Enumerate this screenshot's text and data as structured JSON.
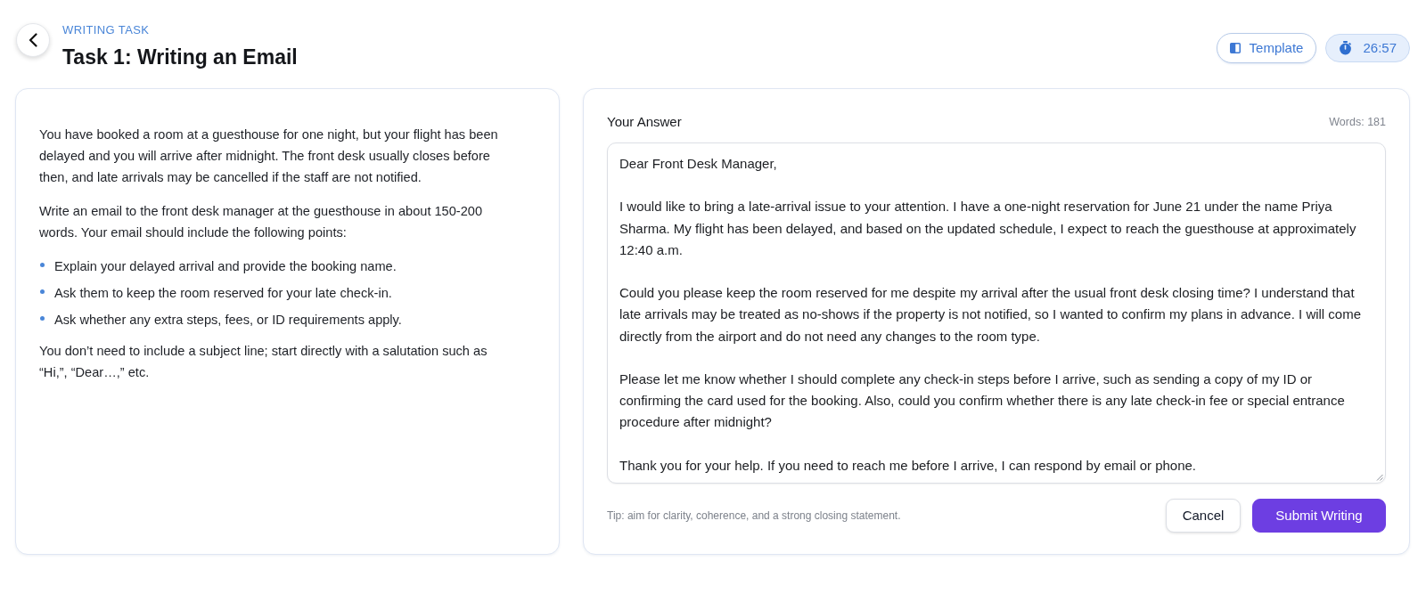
{
  "header": {
    "eyebrow": "WRITING TASK",
    "title": "Task 1: Writing an Email"
  },
  "toolbar": {
    "template_button": "Template",
    "timer": "26:57"
  },
  "prompt": {
    "intro": [
      "You have booked a room at a guesthouse for one night, but your flight has been delayed and you will arrive after midnight. The front desk usually closes before then, and late arrivals may be cancelled if the staff are not notified.",
      "Write an email to the front desk manager at the guesthouse in about 150-200 words. Your email should include the following points:"
    ],
    "points": [
      "Explain your delayed arrival and provide the booking name.",
      "Ask them to keep the room reserved for your late check-in.",
      "Ask whether any extra steps, fees, or ID requirements apply."
    ],
    "note": "You don’t need to include a subject line; start directly with a salutation such as “Hi,”, “Dear…,” etc."
  },
  "answer": {
    "label": "Your Answer",
    "word_count": "Words: 181",
    "value": [
      "Dear Front Desk Manager,",
      "I would like to bring a late-arrival issue to your attention. I have a one-night reservation for June 21 under the name Priya Sharma. My flight has been delayed, and based on the updated schedule, I expect to reach the guesthouse at approximately 12:40 a.m.",
      "Could you please keep the room reserved for me despite my arrival after the usual front desk closing time? I understand that late arrivals may be treated as no-shows if the property is not notified, so I wanted to confirm my plans in advance. I will come directly from the airport and do not need any changes to the room type.",
      "Please let me know whether I should complete any check-in steps before I arrive, such as sending a copy of my ID or confirming the card used for the booking. Also, could you confirm whether there is any late check-in fee or special entrance procedure after midnight?",
      "Thank you for your help. If you need to reach me before I arrive, I can respond by email or phone."
    ],
    "tip": "Tip: aim for clarity, coherence, and a strong closing statement.",
    "buttons": [
      {
        "label": "Cancel",
        "kind": "secondary"
      },
      {
        "label": "Submit Writing",
        "kind": "primary"
      }
    ]
  }
}
